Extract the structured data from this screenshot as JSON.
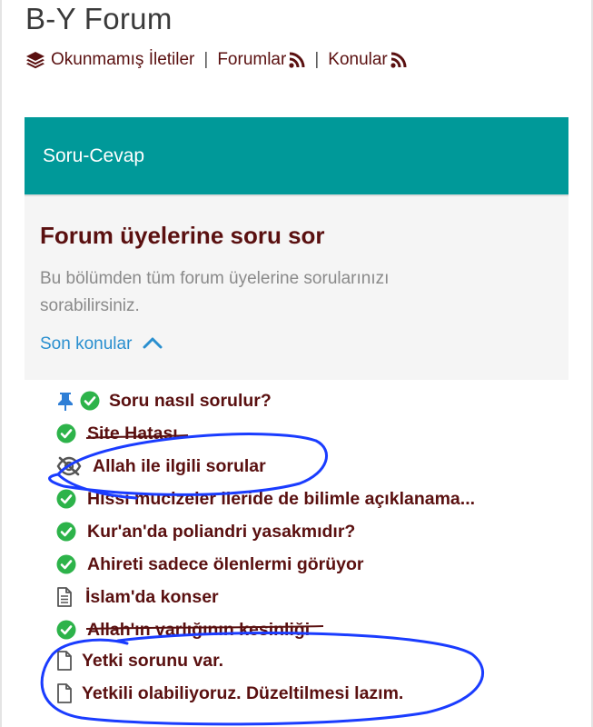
{
  "site": {
    "title": "B-Y Forum"
  },
  "nav": {
    "unread": "Okunmamış İletiler",
    "separator": "|",
    "forums": "Forumlar",
    "topics": "Konular"
  },
  "category": {
    "title": "Soru-Cevap"
  },
  "forum": {
    "title": "Forum üyelerine soru sor",
    "description": "Bu bölümden tüm forum üyelerine sorularınızı sorabilirsiniz.",
    "recent_label": "Son konular"
  },
  "threads": [
    {
      "title": "Soru nasıl sorulur?",
      "icons": [
        "pin-icon",
        "check-circle-icon"
      ]
    },
    {
      "title": "Site Hatası",
      "icons": [
        "check-circle-icon"
      ]
    },
    {
      "title": "Allah ile ilgili sorular",
      "icons": [
        "eye-slash-icon"
      ]
    },
    {
      "title": "Hissi mucizeler ileride de bilimle açıklanama...",
      "icons": [
        "check-circle-icon"
      ]
    },
    {
      "title": "Kur'an'da poliandri yasakmıdır?",
      "icons": [
        "check-circle-icon"
      ]
    },
    {
      "title": "Ahireti sadece ölenlermi görüyor",
      "icons": [
        "check-circle-icon"
      ]
    },
    {
      "title": "İslam'da konser",
      "icons": [
        "document-lines-icon"
      ]
    },
    {
      "title": "Allah'ın varlığının kesinliği",
      "icons": [
        "check-circle-icon"
      ]
    },
    {
      "title": "Yetki sorunu var.",
      "icons": [
        "document-icon"
      ]
    },
    {
      "title": "Yetkili olabiliyoruz. Düzeltilmesi lazım.",
      "icons": [
        "document-icon"
      ]
    }
  ],
  "colors": {
    "accent_header": "#009999",
    "thread_title": "#5a1010",
    "check_green": "#2db34a",
    "pin_blue": "#2f7fd6",
    "link_blue": "#2a8fcf",
    "annotation_ink": "#1a3cff"
  }
}
